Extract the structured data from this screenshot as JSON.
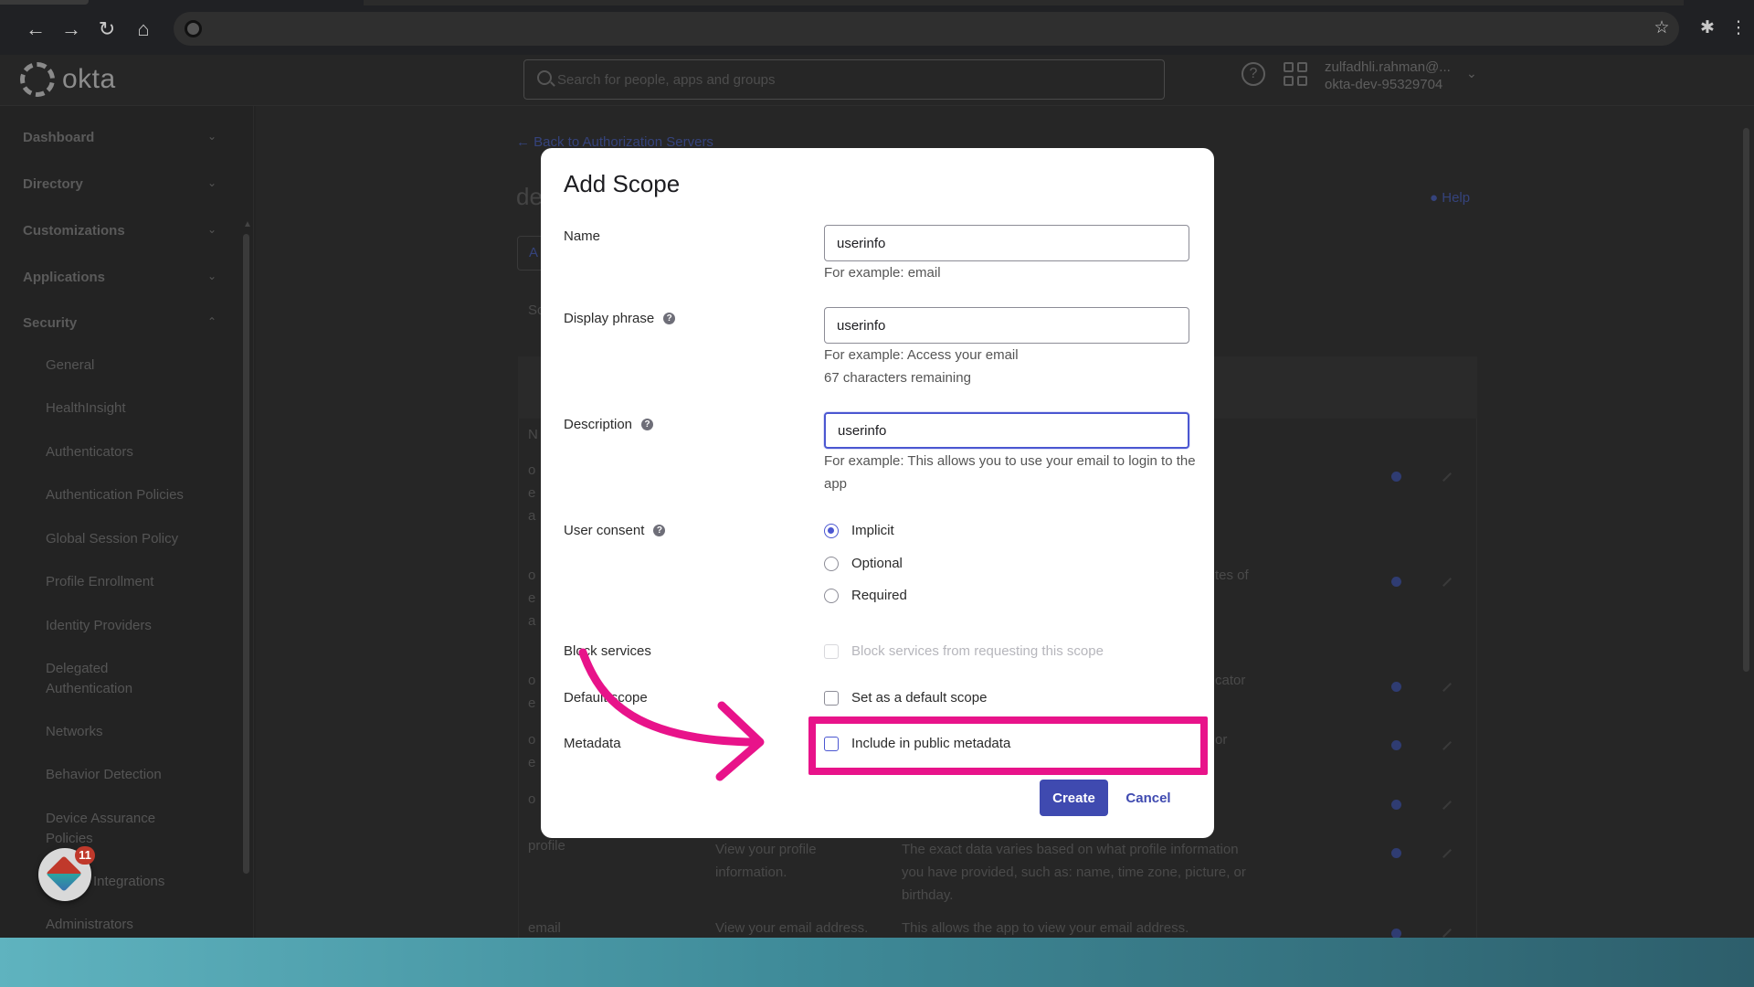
{
  "header": {
    "logo_text": "okta",
    "search_placeholder": "Search for people, apps and groups",
    "user_email": "zulfadhli.rahman@...",
    "user_org": "okta-dev-95329704"
  },
  "sidebar": {
    "sections": [
      {
        "label": "Dashboard"
      },
      {
        "label": "Directory"
      },
      {
        "label": "Customizations"
      },
      {
        "label": "Applications"
      },
      {
        "label": "Security"
      }
    ],
    "security_items": [
      "General",
      "HealthInsight",
      "Authenticators",
      "Authentication Policies",
      "Global Session Policy",
      "Profile Enrollment",
      "Identity Providers",
      "Delegated Authentication",
      "Networks",
      "Behavior Detection",
      "Device Assurance Policies",
      "Integrations",
      "Administrators"
    ]
  },
  "background_page": {
    "back_link": "← Back to Authorization Servers",
    "title_fragment": "de",
    "help_label": "Help",
    "rows": [
      {
        "name": "profile",
        "display": "View your profile information.",
        "description": "The exact data varies based on what profile information you have provided, such as: name, time zone, picture, or birthday."
      },
      {
        "name": "email",
        "display": "View your email address.",
        "description": "This allows the app to view your email address."
      }
    ],
    "fragments": [
      "A",
      "Sc",
      "N",
      "o",
      "e",
      "a",
      "o",
      "e",
      "a",
      "o",
      "e",
      "o",
      "e",
      "o",
      "tes of",
      "cator",
      "or"
    ]
  },
  "widget": {
    "badge_count": "11"
  },
  "modal": {
    "title": "Add Scope",
    "name_label": "Name",
    "name_value": "userinfo",
    "name_hint": "For example: email",
    "display_label": "Display phrase",
    "display_value": "userinfo",
    "display_hint": "For example: Access your email",
    "display_remaining": "67 characters remaining",
    "description_label": "Description",
    "description_value": "userinfo",
    "description_hint": "For example: This allows you to use your email to login to the app",
    "consent_label": "User consent",
    "consent_options": [
      "Implicit",
      "Optional",
      "Required"
    ],
    "consent_selected": "Implicit",
    "block_label": "Block services",
    "block_option": "Block services from requesting this scope",
    "default_label": "Default scope",
    "default_option": "Set as a default scope",
    "metadata_label": "Metadata",
    "metadata_option": "Include in public metadata",
    "create_label": "Create",
    "cancel_label": "Cancel"
  },
  "colors": {
    "accent": "#3f4ab0",
    "highlight": "#e8138a",
    "bottom_bar": "#3f8b99"
  }
}
